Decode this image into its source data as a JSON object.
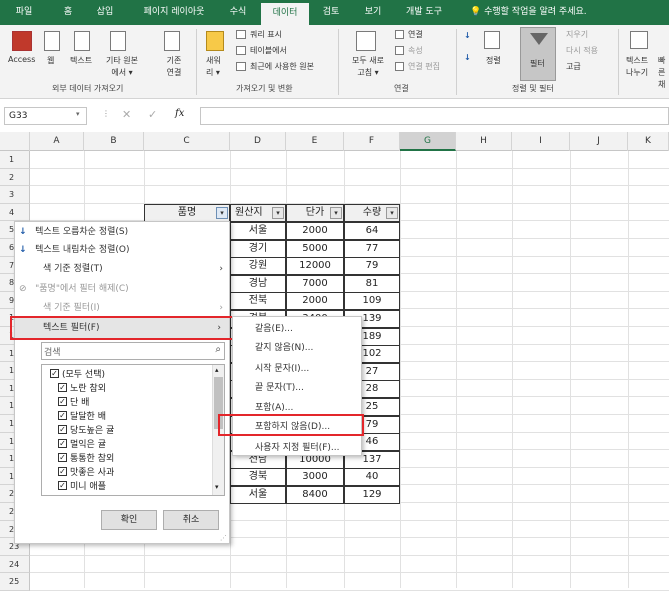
{
  "tabs": [
    "파일",
    "홈",
    "삽입",
    "페이지 레이아웃",
    "수식",
    "데이터",
    "검토",
    "보기",
    "개발 도구",
    "수행할 작업을 알려 주세요."
  ],
  "ribbon": {
    "access": "Access",
    "web": "웹",
    "text": "텍스트",
    "other": "기타 원본에서 ▾",
    "existing": "기존 연결",
    "new_query": "새워 리 ▾",
    "show_query": "쿼리 표시",
    "from_table": "테이블에서",
    "recent": "최근에 사용한 원본",
    "refresh_all": "모두 새로 고침 ▾",
    "connections": "연결",
    "properties": "속성",
    "edit_links": "연결 편집",
    "sort": "정렬",
    "filter": "필터",
    "clear": "지우기",
    "reapply": "다시 적용",
    "advanced": "고급",
    "text_split": "텍스트 나누기",
    "fill": "빠른 채",
    "group_external": "외부 데이터 가져오기",
    "group_transform": "가져오기 및 변환",
    "group_connect": "연결",
    "group_sort": "정렬 및 필터"
  },
  "formula_bar": {
    "name_box": "G33",
    "fx": "fx"
  },
  "columns": [
    "A",
    "B",
    "C",
    "D",
    "E",
    "F",
    "G",
    "H",
    "I",
    "J",
    "K"
  ],
  "rows": [
    "1",
    "2",
    "3",
    "4",
    "5",
    "6",
    "7",
    "8",
    "9",
    "10",
    "11",
    "12",
    "13",
    "14",
    "15",
    "16",
    "17",
    "18",
    "19",
    "20",
    "21",
    "22",
    "23",
    "24",
    "25"
  ],
  "table": {
    "headers": [
      "품명",
      "원산지",
      "단가",
      "수량"
    ],
    "data": [
      [
        "서울",
        "2000",
        "64"
      ],
      [
        "경기",
        "5000",
        "77"
      ],
      [
        "강원",
        "12000",
        "79"
      ],
      [
        "경남",
        "7000",
        "81"
      ],
      [
        "전북",
        "2000",
        "109"
      ],
      [
        "경북",
        "3400",
        "139"
      ],
      [
        "",
        "",
        "189"
      ],
      [
        "",
        "",
        "102"
      ],
      [
        "",
        "",
        "27"
      ],
      [
        "",
        "",
        "28"
      ],
      [
        "",
        "",
        "25"
      ],
      [
        "",
        "",
        "79"
      ],
      [
        "",
        "",
        "46"
      ],
      [
        "전남",
        "10000",
        "137"
      ],
      [
        "경북",
        "3000",
        "40"
      ],
      [
        "서울",
        "8400",
        "129"
      ]
    ]
  },
  "filter_menu": {
    "sort_asc": "텍스트 오름차순 정렬(S)",
    "sort_desc": "텍스트 내림차순 정렬(O)",
    "sort_color": "색 기준 정렬(T)",
    "clear_filter": "\"품명\"에서 필터 해제(C)",
    "filter_color": "색 기준 필터(I)",
    "text_filter": "텍스트 필터(F)",
    "search_placeholder": "검색",
    "items": [
      "(모두 선택)",
      "노란 참외",
      "단 배",
      "달달한 배",
      "당도높은 귤",
      "멀익은 귤",
      "통통한 참외",
      "맛좋은 사과",
      "미니 애플"
    ],
    "ok": "확인",
    "cancel": "취소"
  },
  "submenu": {
    "items": [
      "같음(E)...",
      "같지 않음(N)...",
      "시작 문자(I)...",
      "끝 문자(T)...",
      "포함(A)...",
      "포함하지 않음(D)...",
      "사용자 지정 필터(F)..."
    ]
  },
  "colors": {
    "excel_green": "#217346",
    "highlight_red": "#e3262b"
  }
}
